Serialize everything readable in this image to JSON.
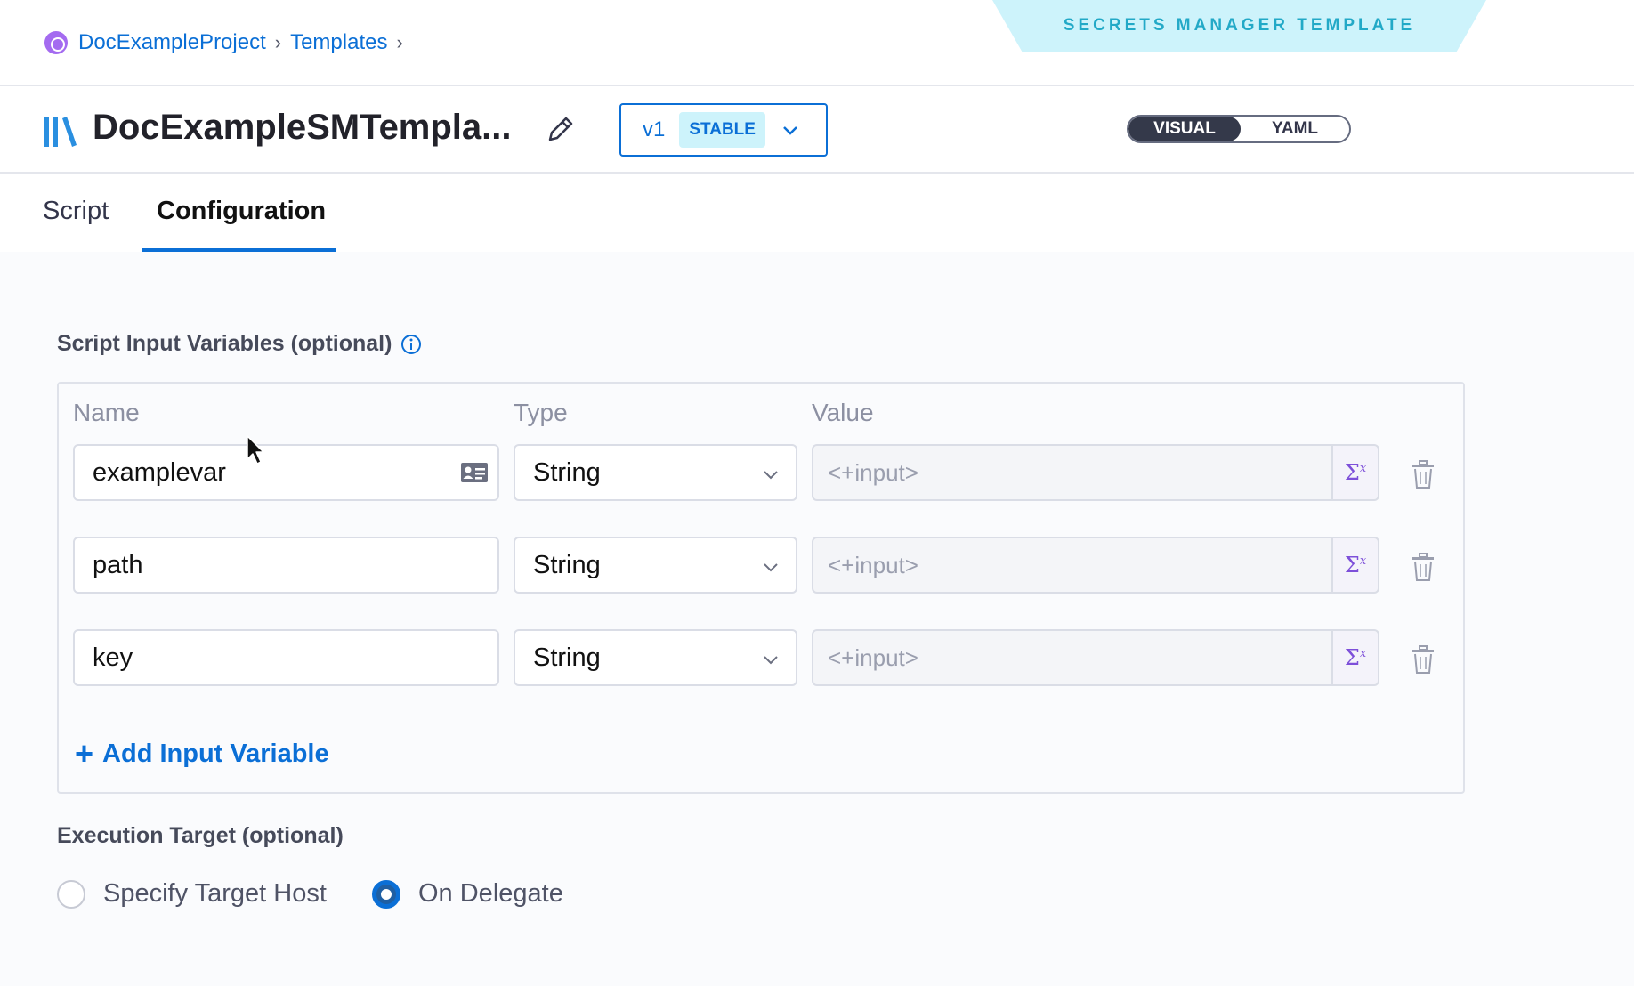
{
  "breadcrumb": {
    "project": "DocExampleProject",
    "section": "Templates"
  },
  "banner": {
    "label": "SECRETS MANAGER TEMPLATE"
  },
  "header": {
    "title": "DocExampleSMTempla...",
    "version": "v1",
    "version_badge": "STABLE",
    "view_toggle": {
      "visual": "VISUAL",
      "yaml": "YAML",
      "active": "VISUAL"
    }
  },
  "tabs": [
    {
      "label": "Script",
      "active": false
    },
    {
      "label": "Configuration",
      "active": true
    }
  ],
  "script_inputs": {
    "label": "Script Input Variables (optional)",
    "columns": {
      "name": "Name",
      "type": "Type",
      "value": "Value"
    },
    "rows": [
      {
        "name": "examplevar",
        "type": "String",
        "value_placeholder": "<+input>"
      },
      {
        "name": "path",
        "type": "String",
        "value_placeholder": "<+input>"
      },
      {
        "name": "key",
        "type": "String",
        "value_placeholder": "<+input>"
      }
    ],
    "add_label": "Add Input Variable",
    "expression_symbol": "Σ"
  },
  "execution_target": {
    "label": "Execution Target (optional)",
    "options": [
      {
        "label": "Specify Target Host",
        "selected": false
      },
      {
        "label": "On Delegate",
        "selected": true
      }
    ]
  },
  "colors": {
    "accent": "#0b6fd6",
    "banner_bg": "#cdf3fb",
    "banner_text": "#22a9c7",
    "expression": "#7d4fd9"
  }
}
